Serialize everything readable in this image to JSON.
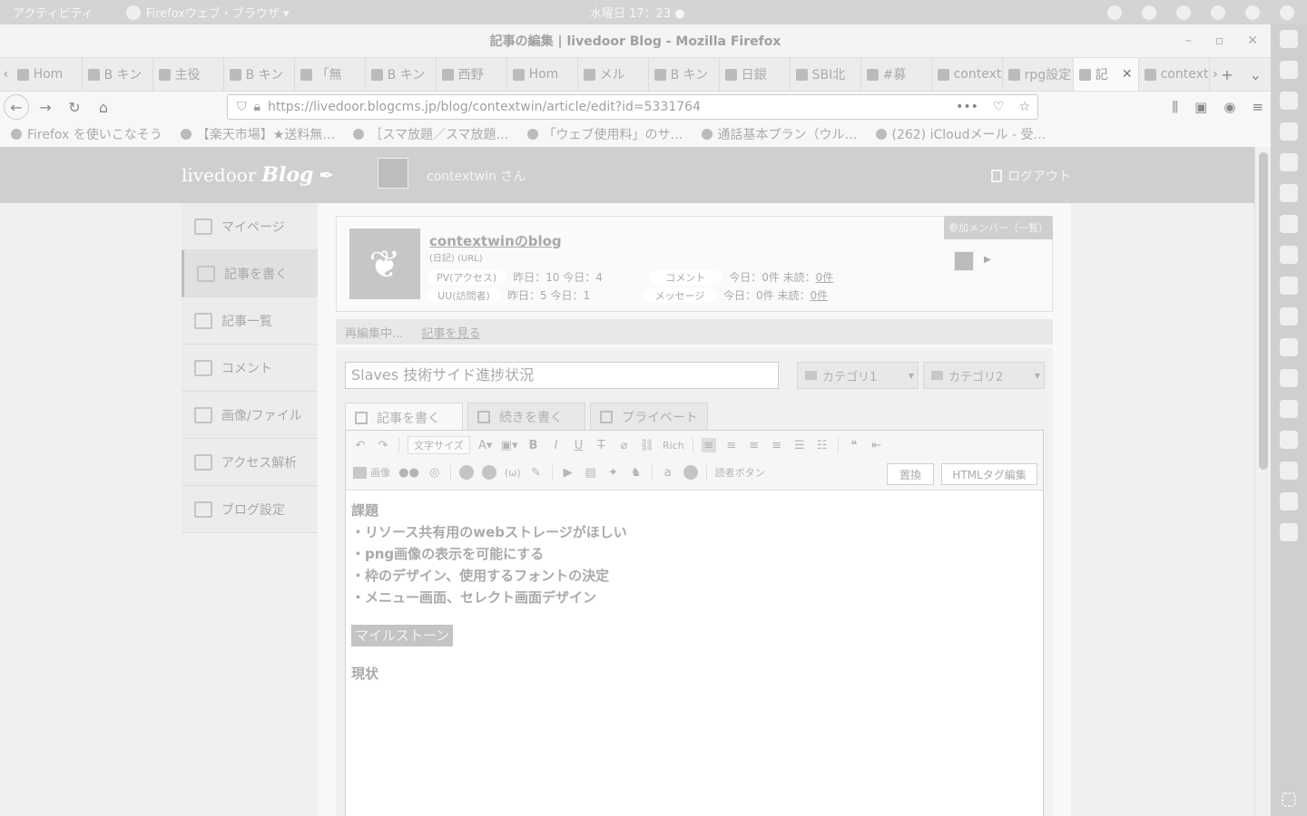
{
  "system_bar": {
    "activities": "アクティビティ",
    "app_menu": "Firefoxウェブ・ブラウザ ▾",
    "clock": "水曜日 17：23 ●"
  },
  "window": {
    "title": "記事の編集 | livedoor Blog - Mozilla Firefox",
    "controls": [
      "–",
      "▫",
      "✕"
    ]
  },
  "tabs": [
    {
      "label": "Hom",
      "icon": "twitter-icon"
    },
    {
      "label": "B キン",
      "icon": "bookmark-b-icon"
    },
    {
      "label": "主役",
      "icon": "cat-icon"
    },
    {
      "label": "B キン",
      "icon": "bookmark-b-icon"
    },
    {
      "label": "「無",
      "icon": "cat-icon"
    },
    {
      "label": "B キン",
      "icon": "bookmark-b-icon"
    },
    {
      "label": "西野",
      "icon": "cat-icon"
    },
    {
      "label": "Hom",
      "icon": "twitter-icon"
    },
    {
      "label": "メル",
      "icon": "mercari-icon"
    },
    {
      "label": "B キン",
      "icon": "bookmark-b-icon"
    },
    {
      "label": "日銀",
      "icon": "bank-icon"
    },
    {
      "label": "SBI北",
      "icon": "bank-icon"
    },
    {
      "label": "#募",
      "icon": "twitter-icon"
    },
    {
      "label": "contextv",
      "icon": "page-icon"
    },
    {
      "label": "rpg設定",
      "icon": "page-icon"
    },
    {
      "label": "記",
      "icon": "edit-icon",
      "active": true
    },
    {
      "label": "contextv",
      "icon": "page-icon"
    }
  ],
  "nav": {
    "url": "https://livedoor.blogcms.jp/blog/contextwin/article/edit?id=5331764"
  },
  "bookmarks": [
    "Firefox を使いこなそう",
    "【楽天市場】★送料無…",
    "［スマ放題／スマ放題…",
    "「ウェブ使用料」のサ…",
    "通話基本プラン（ウル…",
    "(262) iCloudメール - 受…"
  ],
  "site": {
    "logo_text": "livedoor",
    "logo_blog": "Blog",
    "user": "contextwin さん",
    "logout": "ログアウト"
  },
  "sidenav": [
    {
      "label": "マイページ",
      "icon": "home-icon"
    },
    {
      "label": "記事を書く",
      "icon": "pen-icon",
      "active": true
    },
    {
      "label": "記事一覧",
      "icon": "list-icon"
    },
    {
      "label": "コメント",
      "icon": "comment-icon"
    },
    {
      "label": "画像/ファイル",
      "icon": "image-icon"
    },
    {
      "label": "アクセス解析",
      "icon": "chart-icon"
    },
    {
      "label": "ブログ設定",
      "icon": "wrench-icon"
    }
  ],
  "blog_info": {
    "name": "contextwinのblog",
    "sub": "(日記) (URL)",
    "pv_label": "PV(アクセス)",
    "pv_value": "昨日：10 今日：4",
    "uu_label": "UU(訪問者)",
    "uu_value": "昨日：5 今日：1",
    "comment_label": "コメント",
    "comment_value": "今日：0件 未読：",
    "comment_unread": "0件",
    "message_label": "メッセージ",
    "message_value": "今日：0件 未読：",
    "message_unread": "0件",
    "member_tab": "参加メンバー（一覧）"
  },
  "status": {
    "editing": "再編集中...",
    "view_link": "記事を見る"
  },
  "editor": {
    "title_value": "Slaves 技術サイド進捗状況",
    "category1": "カテゴリ1",
    "category2": "カテゴリ2",
    "tab_write": "記事を書く",
    "tab_continue": "続きを書く",
    "tab_private": "プライベート",
    "font_size": "文字サイズ",
    "rich_label": "Rich",
    "image_label": "画像",
    "reader_button": "読者ボタン",
    "replace_button": "置換",
    "html_button": "HTMLタグ編集",
    "content": {
      "heading1": "課題",
      "items": [
        "・リソース共有用のwebストレージがほしい",
        "・png画像の表示を可能にする",
        "・枠のデザイン、使用するフォントの決定",
        "・メニュー画面、セレクト画面デザイン"
      ],
      "milestone": "マイルストーン",
      "heading2": "現状"
    }
  }
}
